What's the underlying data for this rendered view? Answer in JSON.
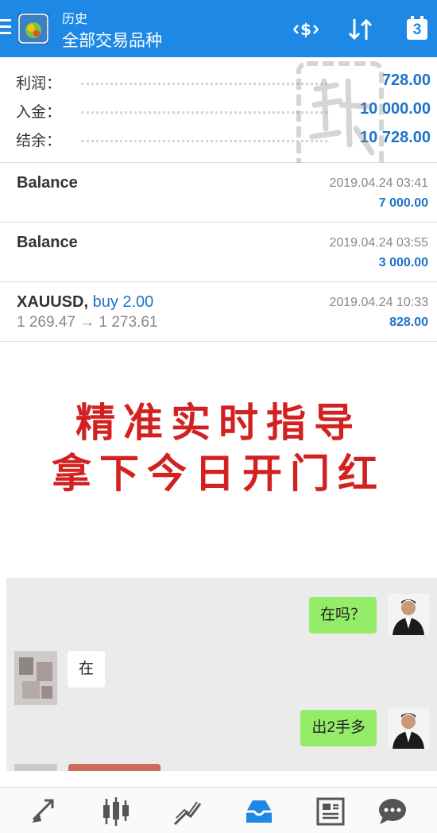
{
  "header": {
    "subtitle": "历史",
    "title": "全部交易品种",
    "calendar_day": "3",
    "colors": {
      "bar": "#1e88e5"
    }
  },
  "summary": [
    {
      "label": "利润：",
      "value": "728.00"
    },
    {
      "label": "入金：",
      "value": "10 000.00"
    },
    {
      "label": "结余：",
      "value": "10 728.00"
    }
  ],
  "deals": [
    {
      "title": "Balance",
      "type": "",
      "prices": "",
      "time": "2019.04.24 03:41",
      "profit": "7 000.00"
    },
    {
      "title": "Balance",
      "type": "",
      "prices": "",
      "time": "2019.04.24 03:55",
      "profit": "3 000.00"
    },
    {
      "title": "XAUUSD,",
      "type": "buy 2.00",
      "prices": "1 269.47 → 1 273.61",
      "time": "2019.04.24 10:33",
      "profit": "828.00"
    }
  ],
  "promo": {
    "line1": "精准实时指导",
    "line2": "拿下今日开门红"
  },
  "chat": {
    "messages": [
      {
        "side": "right",
        "text": "在吗？"
      },
      {
        "side": "left",
        "text": "在"
      },
      {
        "side": "right",
        "text": "出2手多"
      }
    ]
  },
  "bottom_nav": {
    "items": [
      "quotes-icon",
      "chart-icon",
      "trade-icon",
      "history-icon",
      "news-icon",
      "chat-icon"
    ],
    "active": "history-icon",
    "colors": {
      "active": "#1e88e5",
      "inactive": "#555555"
    }
  }
}
